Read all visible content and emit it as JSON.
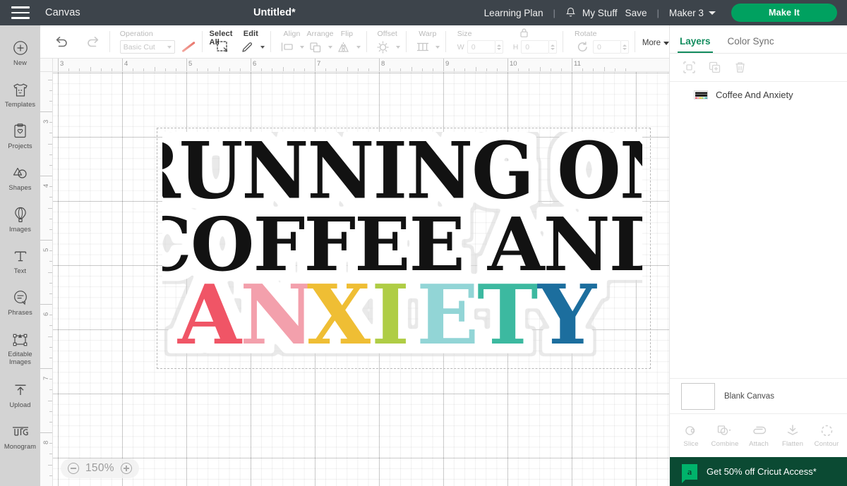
{
  "topbar": {
    "menu_icon": "hamburger-menu-icon",
    "canvas_label": "Canvas",
    "project_title": "Untitled*",
    "learning_plan": "Learning Plan",
    "separator": "|",
    "bell_icon": "notification-bell-icon",
    "my_stuff": "My Stuff",
    "save": "Save",
    "machine": "Maker 3",
    "make_it": "Make It",
    "accent_green": "#00A160",
    "bar_bg": "#3d444b"
  },
  "sidebar": {
    "items": [
      {
        "label": "New",
        "icon": "plus-circle-icon"
      },
      {
        "label": "Templates",
        "icon": "tshirt-icon"
      },
      {
        "label": "Projects",
        "icon": "project-card-icon"
      },
      {
        "label": "Shapes",
        "icon": "shapes-icon"
      },
      {
        "label": "Images",
        "icon": "hot-air-balloon-icon"
      },
      {
        "label": "Text",
        "icon": "text-t-icon"
      },
      {
        "label": "Phrases",
        "icon": "speech-bubble-icon"
      },
      {
        "label": "Editable Images",
        "icon": "editable-images-icon"
      },
      {
        "label": "Upload",
        "icon": "upload-arrow-icon"
      },
      {
        "label": "Monogram",
        "icon": "monogram-icon"
      }
    ]
  },
  "toolbar": {
    "undo_icon": "undo-arrow-icon",
    "redo_icon": "redo-arrow-icon",
    "operation_label": "Operation",
    "operation_value": "Basic Cut",
    "pen_color_icon": "pen-stroke-icon",
    "select_all_label": "Select All",
    "select_all_icon": "select-all-icon",
    "edit_label": "Edit",
    "edit_icon": "pencil-icon",
    "align_label": "Align",
    "align_icon": "align-icon",
    "arrange_label": "Arrange",
    "arrange_icon": "arrange-icon",
    "flip_label": "Flip",
    "flip_icon": "flip-icon",
    "offset_label": "Offset",
    "offset_icon": "offset-icon",
    "warp_label": "Warp",
    "warp_icon": "warp-icon",
    "size_label": "Size",
    "lock_icon": "lock-closed-icon",
    "width_label": "W",
    "width_value": "0",
    "height_label": "H",
    "height_value": "0",
    "rotate_label": "Rotate",
    "rotate_icon": "rotate-icon",
    "rotate_value": "0",
    "more_label": "More"
  },
  "canvas": {
    "ruler_h": [
      "3",
      "4",
      "5",
      "6",
      "7",
      "8",
      "9",
      "10",
      "11"
    ],
    "ruler_v": [
      "3",
      "4",
      "5",
      "6",
      "7",
      "8"
    ],
    "zoom_level": "150%",
    "zoom_out_icon": "zoom-out-circle-icon",
    "zoom_in_icon": "zoom-in-circle-icon",
    "artwork": {
      "line1": "RUNNING ON",
      "line2": "COFFEE AND",
      "line3": "ANXIETY",
      "line1_color": "#121212",
      "line2_color": "#121212",
      "sticker_outline_color": "#ffffff",
      "anxiety_letters": [
        {
          "char": "A",
          "color": "#F05566"
        },
        {
          "char": "N",
          "color": "#F3A0AC"
        },
        {
          "char": "X",
          "color": "#EFBE34"
        },
        {
          "char": "I",
          "color": "#AFCD45"
        },
        {
          "char": "E",
          "color": "#92D5D6"
        },
        {
          "char": "T",
          "color": "#3CB9A0"
        },
        {
          "char": "Y",
          "color": "#1C6E9E"
        }
      ]
    }
  },
  "right_panel": {
    "tabs": [
      {
        "label": "Layers",
        "active": true
      },
      {
        "label": "Color Sync",
        "active": false
      }
    ],
    "action_icons": [
      "group-icon",
      "duplicate-icon",
      "delete-trash-icon"
    ],
    "layers": [
      {
        "name": "Coffee And Anxiety",
        "thumb": "artwork-thumbnail"
      }
    ],
    "blank_canvas_label": "Blank Canvas",
    "bottom_tools": [
      {
        "label": "Slice",
        "icon": "slice-icon"
      },
      {
        "label": "Combine",
        "icon": "combine-icon"
      },
      {
        "label": "Attach",
        "icon": "attach-paperclip-icon"
      },
      {
        "label": "Flatten",
        "icon": "flatten-icon"
      },
      {
        "label": "Contour",
        "icon": "contour-dashed-circle-icon"
      }
    ],
    "access_banner": {
      "text": "Get 50% off Cricut Access*",
      "logo_glyph": "a",
      "bg": "#0b4a33"
    }
  }
}
